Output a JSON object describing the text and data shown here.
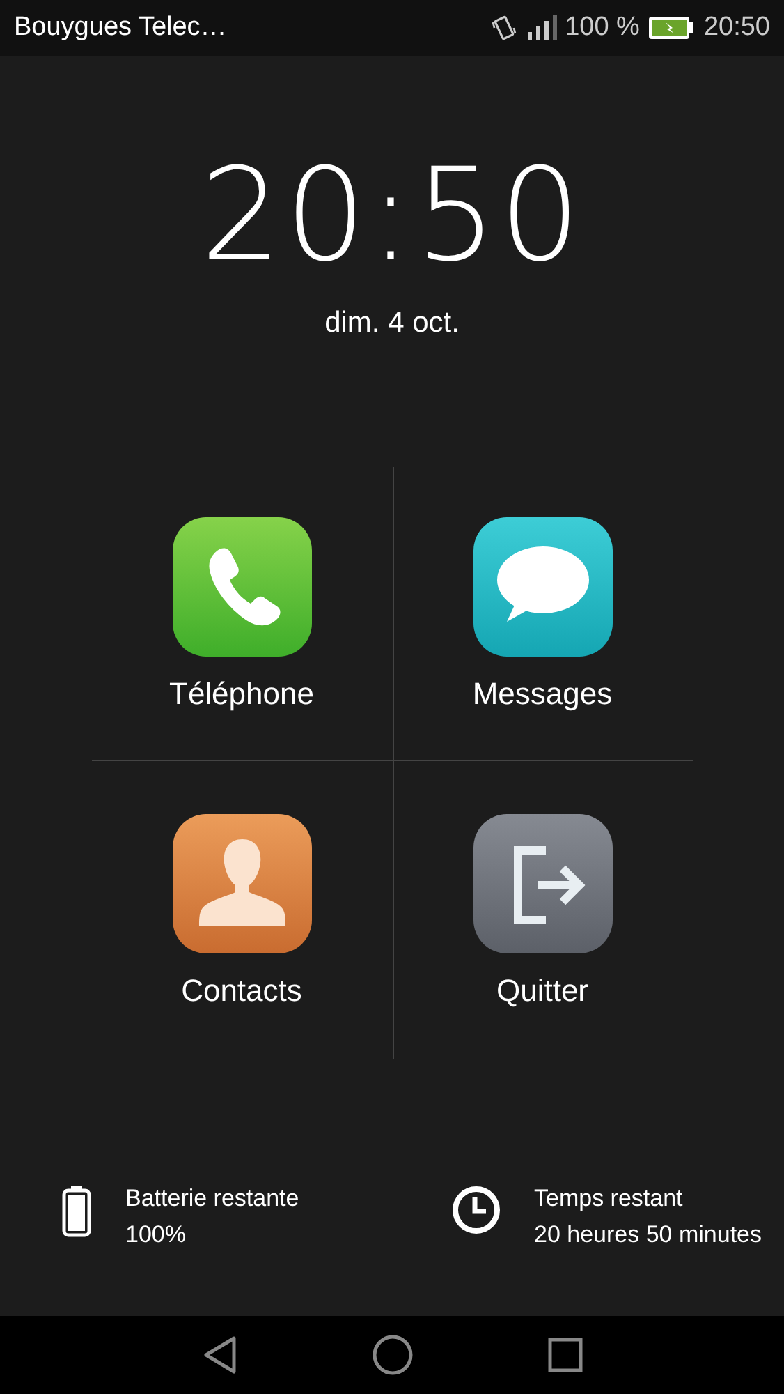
{
  "status_bar": {
    "carrier": "Bouygues Telec…",
    "battery": "100 %",
    "time": "20:50"
  },
  "clock": {
    "time": "20:50",
    "date": "dim. 4 oct."
  },
  "apps": [
    {
      "kind": "phone",
      "label": "Téléphone"
    },
    {
      "kind": "messages",
      "label": "Messages"
    },
    {
      "kind": "contacts",
      "label": "Contacts"
    },
    {
      "kind": "exit",
      "label": "Quitter"
    }
  ],
  "info": [
    {
      "kind": "battery",
      "title": "Batterie restante",
      "value": "100%"
    },
    {
      "kind": "clock",
      "title": "Temps restant",
      "value": "20 heures 50 minutes"
    }
  ]
}
